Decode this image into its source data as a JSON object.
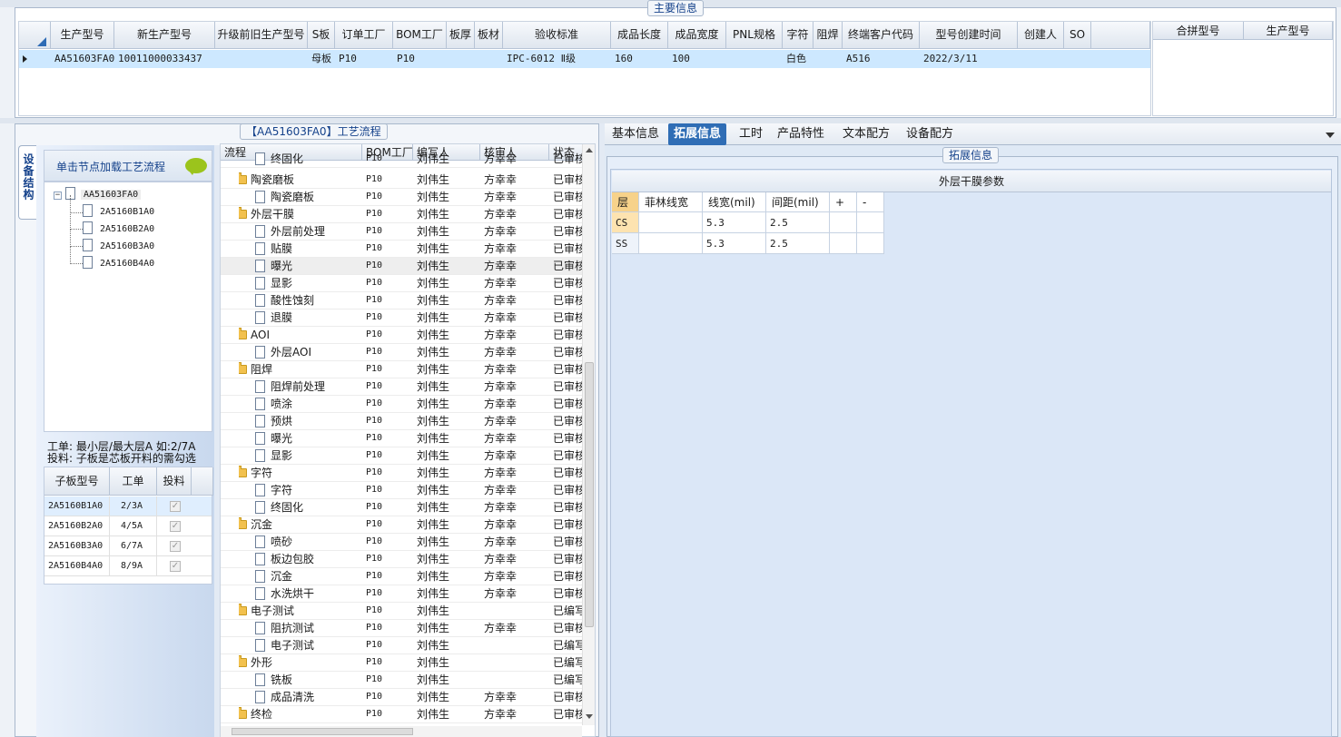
{
  "main_info": {
    "title": "主要信息",
    "columns": [
      "生产型号",
      "新生产型号",
      "升级前旧生产型号",
      "S板",
      "订单工厂",
      "BOM工厂",
      "板厚",
      "板材",
      "验收标准",
      "成品长度",
      "成品宽度",
      "PNL规格",
      "字符",
      "阻焊",
      "终端客户代码",
      "型号创建时间",
      "创建人",
      "SO"
    ],
    "row": {
      "prod_model": "AA51603FA0",
      "new_model": "10011000033437",
      "old_model": "",
      "s_board": "母板",
      "order_factory": "P10",
      "bom_factory": "P10",
      "thickness": "",
      "material": "",
      "standard": "IPC-6012 Ⅱ级",
      "length": "160",
      "width": "100",
      "pnl": "",
      "char": "白色",
      "solder": "",
      "customer": "A516",
      "created": "2022/3/11",
      "creator": "",
      "so": ""
    },
    "merge_columns": [
      "合拼型号",
      "生产型号"
    ]
  },
  "left_panel": {
    "vertical_tab": "设备结构",
    "hint": "单击节点加载工艺流程",
    "tree": {
      "root": "AA51603FA0",
      "children": [
        "2A5160B1A0",
        "2A5160B2A0",
        "2A5160B3A0",
        "2A5160B4A0"
      ]
    },
    "note_line1": "工单: 最小层/最大层A 如:2/7A",
    "note_line2": "投料: 子板是芯板开料的需勾选",
    "sub_table": {
      "headers": [
        "子板型号",
        "工单",
        "投料"
      ],
      "rows": [
        {
          "model": "2A5160B1A0",
          "order": "2/3A"
        },
        {
          "model": "2A5160B2A0",
          "order": "4/5A"
        },
        {
          "model": "2A5160B3A0",
          "order": "6/7A"
        },
        {
          "model": "2A5160B4A0",
          "order": "8/9A"
        }
      ]
    }
  },
  "process": {
    "title": "【AA51603FA0】工艺流程",
    "headers": [
      "流程",
      "BOM工厂",
      "编写人",
      "核审人",
      "状态"
    ],
    "rows": [
      {
        "name": "终固化",
        "lvl": 2,
        "bom": "P10",
        "writer": "刘伟生",
        "reviewer": "方幸幸",
        "status": "已审核"
      },
      {
        "name": "陶瓷磨板",
        "lvl": 1,
        "bom": "P10",
        "writer": "刘伟生",
        "reviewer": "方幸幸",
        "status": "已审核"
      },
      {
        "name": "陶瓷磨板",
        "lvl": 2,
        "bom": "P10",
        "writer": "刘伟生",
        "reviewer": "方幸幸",
        "status": "已审核"
      },
      {
        "name": "外层干膜",
        "lvl": 1,
        "bom": "P10",
        "writer": "刘伟生",
        "reviewer": "方幸幸",
        "status": "已审核"
      },
      {
        "name": "外层前处理",
        "lvl": 2,
        "bom": "P10",
        "writer": "刘伟生",
        "reviewer": "方幸幸",
        "status": "已审核"
      },
      {
        "name": "贴膜",
        "lvl": 2,
        "bom": "P10",
        "writer": "刘伟生",
        "reviewer": "方幸幸",
        "status": "已审核"
      },
      {
        "name": "曝光",
        "lvl": 2,
        "bom": "P10",
        "writer": "刘伟生",
        "reviewer": "方幸幸",
        "status": "已审核"
      },
      {
        "name": "显影",
        "lvl": 2,
        "bom": "P10",
        "writer": "刘伟生",
        "reviewer": "方幸幸",
        "status": "已审核"
      },
      {
        "name": "酸性蚀刻",
        "lvl": 2,
        "bom": "P10",
        "writer": "刘伟生",
        "reviewer": "方幸幸",
        "status": "已审核"
      },
      {
        "name": "退膜",
        "lvl": 2,
        "bom": "P10",
        "writer": "刘伟生",
        "reviewer": "方幸幸",
        "status": "已审核"
      },
      {
        "name": "AOI",
        "lvl": 1,
        "bom": "P10",
        "writer": "刘伟生",
        "reviewer": "方幸幸",
        "status": "已审核"
      },
      {
        "name": "外层AOI",
        "lvl": 2,
        "bom": "P10",
        "writer": "刘伟生",
        "reviewer": "方幸幸",
        "status": "已审核"
      },
      {
        "name": "阻焊",
        "lvl": 1,
        "bom": "P10",
        "writer": "刘伟生",
        "reviewer": "方幸幸",
        "status": "已审核"
      },
      {
        "name": "阻焊前处理",
        "lvl": 2,
        "bom": "P10",
        "writer": "刘伟生",
        "reviewer": "方幸幸",
        "status": "已审核"
      },
      {
        "name": "喷涂",
        "lvl": 2,
        "bom": "P10",
        "writer": "刘伟生",
        "reviewer": "方幸幸",
        "status": "已审核"
      },
      {
        "name": "预烘",
        "lvl": 2,
        "bom": "P10",
        "writer": "刘伟生",
        "reviewer": "方幸幸",
        "status": "已审核"
      },
      {
        "name": "曝光",
        "lvl": 2,
        "bom": "P10",
        "writer": "刘伟生",
        "reviewer": "方幸幸",
        "status": "已审核"
      },
      {
        "name": "显影",
        "lvl": 2,
        "bom": "P10",
        "writer": "刘伟生",
        "reviewer": "方幸幸",
        "status": "已审核"
      },
      {
        "name": "字符",
        "lvl": 1,
        "bom": "P10",
        "writer": "刘伟生",
        "reviewer": "方幸幸",
        "status": "已审核"
      },
      {
        "name": "字符",
        "lvl": 2,
        "bom": "P10",
        "writer": "刘伟生",
        "reviewer": "方幸幸",
        "status": "已审核"
      },
      {
        "name": "终固化",
        "lvl": 2,
        "bom": "P10",
        "writer": "刘伟生",
        "reviewer": "方幸幸",
        "status": "已审核"
      },
      {
        "name": "沉金",
        "lvl": 1,
        "bom": "P10",
        "writer": "刘伟生",
        "reviewer": "方幸幸",
        "status": "已审核"
      },
      {
        "name": "喷砂",
        "lvl": 2,
        "bom": "P10",
        "writer": "刘伟生",
        "reviewer": "方幸幸",
        "status": "已审核"
      },
      {
        "name": "板边包胶",
        "lvl": 2,
        "bom": "P10",
        "writer": "刘伟生",
        "reviewer": "方幸幸",
        "status": "已审核"
      },
      {
        "name": "沉金",
        "lvl": 2,
        "bom": "P10",
        "writer": "刘伟生",
        "reviewer": "方幸幸",
        "status": "已审核"
      },
      {
        "name": "水洗烘干",
        "lvl": 2,
        "bom": "P10",
        "writer": "刘伟生",
        "reviewer": "方幸幸",
        "status": "已审核"
      },
      {
        "name": "电子测试",
        "lvl": 1,
        "bom": "P10",
        "writer": "刘伟生",
        "reviewer": "",
        "status": "已编写"
      },
      {
        "name": "阻抗测试",
        "lvl": 2,
        "bom": "P10",
        "writer": "刘伟生",
        "reviewer": "方幸幸",
        "status": "已审核"
      },
      {
        "name": "电子测试",
        "lvl": 2,
        "bom": "P10",
        "writer": "刘伟生",
        "reviewer": "",
        "status": "已编写"
      },
      {
        "name": "外形",
        "lvl": 1,
        "bom": "P10",
        "writer": "刘伟生",
        "reviewer": "",
        "status": "已编写"
      },
      {
        "name": "铣板",
        "lvl": 2,
        "bom": "P10",
        "writer": "刘伟生",
        "reviewer": "",
        "status": "已编写"
      },
      {
        "name": "成品清洗",
        "lvl": 2,
        "bom": "P10",
        "writer": "刘伟生",
        "reviewer": "方幸幸",
        "status": "已审核"
      },
      {
        "name": "终检",
        "lvl": 1,
        "bom": "P10",
        "writer": "刘伟生",
        "reviewer": "方幸幸",
        "status": "已审核"
      }
    ]
  },
  "right_panel": {
    "tabs": [
      "基本信息",
      "拓展信息",
      "工时",
      "产品特性",
      "文本配方",
      "设备配方"
    ],
    "active_tab": "拓展信息",
    "ext_title": "拓展信息",
    "table_title": "外层干膜参数",
    "headers": [
      "层",
      "菲林线宽",
      "线宽(mil)",
      "间距(mil)",
      "+",
      "-"
    ],
    "rows": [
      {
        "layer": "CS",
        "film": "",
        "width": "5.3",
        "spacing": "2.5"
      },
      {
        "layer": "SS",
        "film": "",
        "width": "5.3",
        "spacing": "2.5"
      }
    ]
  },
  "colors": {
    "selected_row": "#cde8ff",
    "panel_bg": "#dfe9f5",
    "active_tab": "#2f6db5",
    "header_gradient_top": "#f7f9fc"
  }
}
